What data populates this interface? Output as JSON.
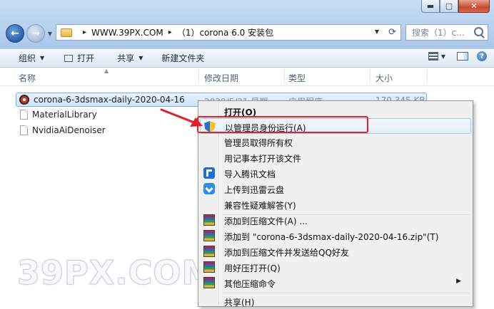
{
  "window": {
    "buttons": {
      "minimize": "▬",
      "maximize": "▢",
      "close": "✕"
    }
  },
  "address_bar": {
    "crumbs": [
      "WWW.39PX.COM",
      "（1）corona 6.0 安装包"
    ],
    "separator": "▸"
  },
  "search": {
    "placeholder": "搜索（1）c..."
  },
  "toolbar": {
    "organize_label": "组织",
    "open_label": "打开",
    "share_label": "共享",
    "new_folder_label": "新建文件夹"
  },
  "columns": {
    "name": "名称",
    "modified": "修改日期",
    "type": "类型",
    "size": "大小"
  },
  "files": [
    {
      "name": "corona-6-3dsmax-daily-2020-04-16",
      "modified": "2020/5/21 星期",
      "type": "应用程序",
      "size": "170,345 KB",
      "icon": "corona-app-icon"
    },
    {
      "name": "MaterialLibrary",
      "icon": "document-icon"
    },
    {
      "name": "NvidiaAiDenoiser",
      "icon": "document-icon"
    }
  ],
  "context_menu": {
    "items": [
      {
        "label": "打开(O)",
        "icon": ""
      },
      {
        "label": "以管理员身份运行(A)",
        "icon": "uac-shield-icon"
      },
      {
        "label": "管理员取得所有权",
        "icon": ""
      },
      {
        "label": "用记事本打开该文件",
        "icon": ""
      },
      {
        "label": "导入腾讯文档",
        "icon": "tencent-docs-icon"
      },
      {
        "label": "上传到迅雷云盘",
        "icon": "thunder-cloud-icon"
      },
      {
        "label": "兼容性疑难解答(Y)",
        "icon": ""
      },
      {
        "label": "添加到压缩文件(A) ...",
        "icon": "winrar-icon"
      },
      {
        "label": "添加到 \"corona-6-3dsmax-daily-2020-04-16.zip\"(T)",
        "icon": "winrar-icon"
      },
      {
        "label": "添加到压缩文件并发送给QQ好友",
        "icon": "winrar-icon"
      },
      {
        "label": "用好压打开(Q)",
        "icon": "winrar-icon"
      },
      {
        "label": "其他压缩命令",
        "icon": "winrar-icon",
        "submenu_arrow": "▶"
      },
      {
        "label": "共享(H)",
        "icon": ""
      }
    ]
  },
  "annotation": {
    "highlight_color": "#e0202a"
  },
  "watermark": {
    "text": "39PX.COM"
  }
}
